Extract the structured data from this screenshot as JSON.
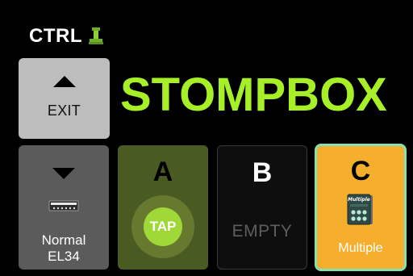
{
  "header": {
    "label": "CTRL",
    "icon": "pin-icon"
  },
  "exit_button": {
    "label": "EXIT",
    "icon": "triangle-up-icon"
  },
  "title": "STOMPBOX",
  "tiles": [
    {
      "id": "normal",
      "icon": "triangle-down-icon",
      "secondary_icon": "amp-model-icon",
      "label_line1": "Normal",
      "label_line2": "EL34"
    },
    {
      "id": "a",
      "letter": "A",
      "button_label": "TAP"
    },
    {
      "id": "b",
      "letter": "B",
      "label": "EMPTY"
    },
    {
      "id": "c",
      "letter": "C",
      "icon": "effect-pedal-icon",
      "icon_text": "Multiple",
      "label": "Multiple"
    }
  ],
  "colors": {
    "accent_green": "#a7ef26",
    "tile_a_bg": "#4a5a23",
    "tap_button": "#9fd837",
    "tile_c_bg": "#f6ae2d",
    "selected_border": "#86e0b4"
  }
}
